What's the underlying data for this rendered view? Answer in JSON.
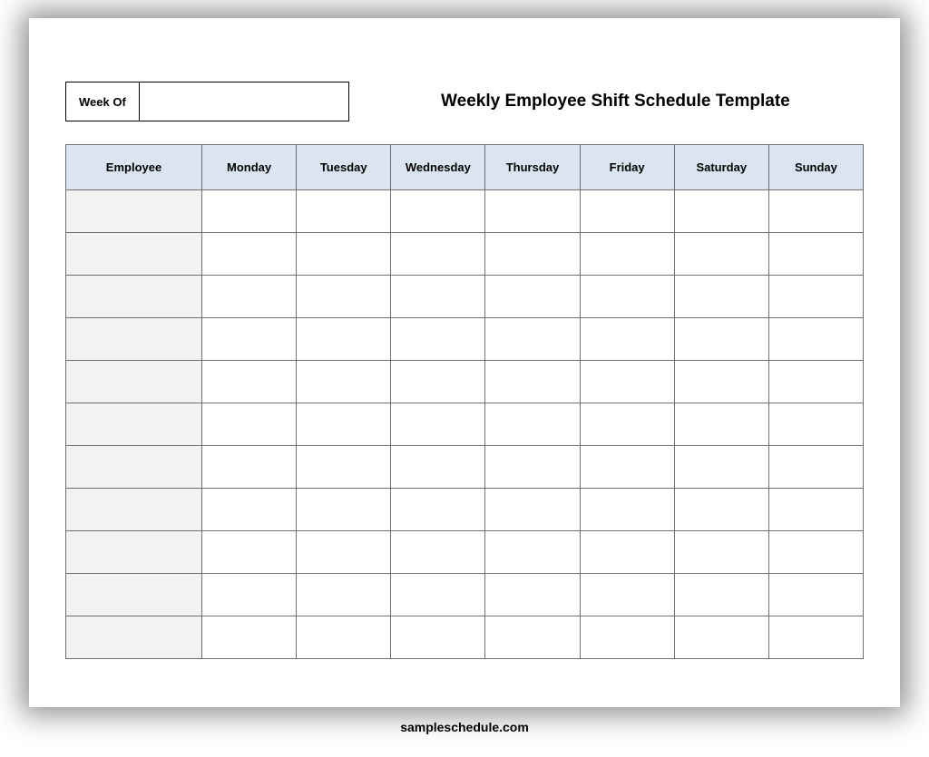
{
  "header": {
    "week_of_label": "Week Of",
    "week_of_value": "",
    "title": "Weekly Employee Shift Schedule Template"
  },
  "table": {
    "columns": [
      "Employee",
      "Monday",
      "Tuesday",
      "Wednesday",
      "Thursday",
      "Friday",
      "Saturday",
      "Sunday"
    ],
    "rows": [
      {
        "employee": "",
        "monday": "",
        "tuesday": "",
        "wednesday": "",
        "thursday": "",
        "friday": "",
        "saturday": "",
        "sunday": ""
      },
      {
        "employee": "",
        "monday": "",
        "tuesday": "",
        "wednesday": "",
        "thursday": "",
        "friday": "",
        "saturday": "",
        "sunday": ""
      },
      {
        "employee": "",
        "monday": "",
        "tuesday": "",
        "wednesday": "",
        "thursday": "",
        "friday": "",
        "saturday": "",
        "sunday": ""
      },
      {
        "employee": "",
        "monday": "",
        "tuesday": "",
        "wednesday": "",
        "thursday": "",
        "friday": "",
        "saturday": "",
        "sunday": ""
      },
      {
        "employee": "",
        "monday": "",
        "tuesday": "",
        "wednesday": "",
        "thursday": "",
        "friday": "",
        "saturday": "",
        "sunday": ""
      },
      {
        "employee": "",
        "monday": "",
        "tuesday": "",
        "wednesday": "",
        "thursday": "",
        "friday": "",
        "saturday": "",
        "sunday": ""
      },
      {
        "employee": "",
        "monday": "",
        "tuesday": "",
        "wednesday": "",
        "thursday": "",
        "friday": "",
        "saturday": "",
        "sunday": ""
      },
      {
        "employee": "",
        "monday": "",
        "tuesday": "",
        "wednesday": "",
        "thursday": "",
        "friday": "",
        "saturday": "",
        "sunday": ""
      },
      {
        "employee": "",
        "monday": "",
        "tuesday": "",
        "wednesday": "",
        "thursday": "",
        "friday": "",
        "saturday": "",
        "sunday": ""
      },
      {
        "employee": "",
        "monday": "",
        "tuesday": "",
        "wednesday": "",
        "thursday": "",
        "friday": "",
        "saturday": "",
        "sunday": ""
      },
      {
        "employee": "",
        "monday": "",
        "tuesday": "",
        "wednesday": "",
        "thursday": "",
        "friday": "",
        "saturday": "",
        "sunday": ""
      }
    ]
  },
  "footer": {
    "text": "sampleschedule.com"
  }
}
